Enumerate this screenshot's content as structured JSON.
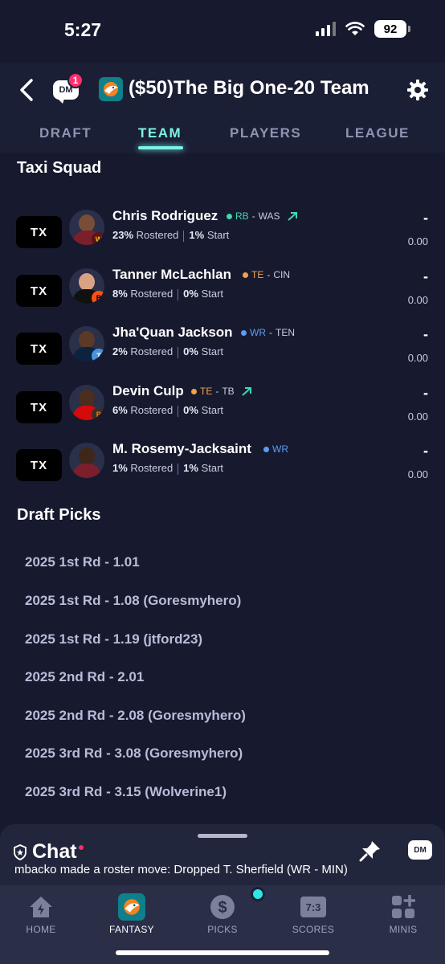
{
  "status_bar": {
    "time": "5:27",
    "battery": "92"
  },
  "header": {
    "title": "($50)The Big One-20 Team",
    "dm_label": "DM",
    "dm_badge": "1",
    "tabs": [
      {
        "label": "DRAFT"
      },
      {
        "label": "TEAM"
      },
      {
        "label": "PLAYERS"
      },
      {
        "label": "LEAGUE"
      }
    ],
    "active_tab": "TEAM"
  },
  "taxi_squad": {
    "title": "Taxi Squad",
    "players": [
      {
        "slot": "TX",
        "name": "Chris Rodriguez",
        "position": "RB",
        "team": "WAS",
        "pos_color": "#3fd7b0",
        "trend": "up",
        "rostered_pct": "23%",
        "rostered_label": "Rostered",
        "start_pct": "1%",
        "start_label": "Start",
        "dash": "-",
        "points": "0.00"
      },
      {
        "slot": "TX",
        "name": "Tanner McLachlan",
        "position": "TE",
        "team": "CIN",
        "pos_color": "#f5a04a",
        "trend": "",
        "rostered_pct": "8%",
        "rostered_label": "Rostered",
        "start_pct": "0%",
        "start_label": "Start",
        "dash": "-",
        "points": "0.00"
      },
      {
        "slot": "TX",
        "name": "Jha'Quan Jackson",
        "position": "WR",
        "team": "TEN",
        "pos_color": "#5b9cf5",
        "trend": "",
        "rostered_pct": "2%",
        "rostered_label": "Rostered",
        "start_pct": "0%",
        "start_label": "Start",
        "dash": "-",
        "points": "0.00"
      },
      {
        "slot": "TX",
        "name": "Devin Culp",
        "position": "TE",
        "team": "TB",
        "pos_color": "#f5a04a",
        "trend": "up",
        "rostered_pct": "6%",
        "rostered_label": "Rostered",
        "start_pct": "0%",
        "start_label": "Start",
        "dash": "-",
        "points": "0.00"
      },
      {
        "slot": "TX",
        "name": "M. Rosemy-Jacksaint",
        "position": "WR",
        "team": "",
        "pos_color": "#5b9cf5",
        "trend": "",
        "rostered_pct": "1%",
        "rostered_label": "Rostered",
        "start_pct": "1%",
        "start_label": "Start",
        "dash": "-",
        "points": "0.00"
      }
    ]
  },
  "draft_picks": {
    "title": "Draft Picks",
    "picks": [
      "2025 1st Rd - 1.01",
      "2025 1st Rd - 1.08 (Goresmyhero)",
      "2025 1st Rd - 1.19 (jtford23)",
      "2025 2nd Rd - 2.01",
      "2025 2nd Rd - 2.08 (Goresmyhero)",
      "2025 3rd Rd - 3.08 (Goresmyhero)",
      "2025 3rd Rd - 3.15 (Wolverine1)"
    ]
  },
  "chat": {
    "title": "Chat",
    "message": "mbacko made a roster move: Dropped T. Sherfield (WR - MIN)",
    "dm_label": "DM"
  },
  "bottom_nav": {
    "items": [
      {
        "label": "HOME",
        "icon": "home-icon"
      },
      {
        "label": "FANTASY",
        "icon": "team-logo-icon"
      },
      {
        "label": "PICKS",
        "icon": "dollar-icon"
      },
      {
        "label": "SCORES",
        "icon": "scoreboard-icon",
        "icon_text": "7:3"
      },
      {
        "label": "MINIS",
        "icon": "grid-plus-icon"
      }
    ],
    "active": "FANTASY"
  },
  "colors": {
    "background": "#171a2e",
    "accent": "#7cf4e8",
    "badge": "#ff2d6b"
  }
}
